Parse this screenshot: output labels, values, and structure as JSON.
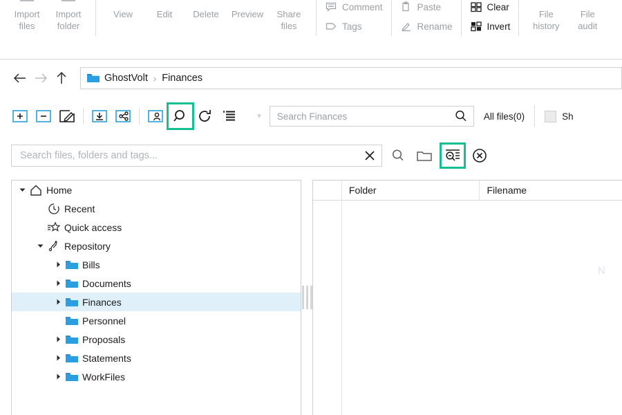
{
  "ribbon": {
    "groups": [
      {
        "name": "import",
        "buttons": [
          {
            "label_line1": "Import",
            "label_line2": "files",
            "icon": "import-files-icon"
          },
          {
            "label_line1": "Import",
            "label_line2": "folder",
            "icon": "import-folder-icon"
          }
        ]
      },
      {
        "name": "file-actions",
        "buttons": [
          {
            "label_line1": "View",
            "label_line2": "",
            "icon": "view-icon"
          },
          {
            "label_line1": "Edit",
            "label_line2": "",
            "icon": "edit-icon"
          },
          {
            "label_line1": "Delete",
            "label_line2": "",
            "icon": "delete-icon"
          },
          {
            "label_line1": "Preview",
            "label_line2": "",
            "icon": "preview-icon"
          },
          {
            "label_line1": "Share",
            "label_line2": "files",
            "icon": "share-files-icon"
          }
        ]
      },
      {
        "name": "annotate",
        "small_buttons": [
          {
            "label": "Comment",
            "icon": "comment-icon",
            "enabled": false
          },
          {
            "label": "Tags",
            "icon": "tag-icon",
            "enabled": false
          }
        ]
      },
      {
        "name": "clipboard",
        "small_buttons": [
          {
            "label": "Paste",
            "icon": "paste-icon",
            "enabled": false
          },
          {
            "label": "Rename",
            "icon": "rename-pencil-icon",
            "enabled": false
          }
        ]
      },
      {
        "name": "selection",
        "small_buttons": [
          {
            "label": "Clear",
            "icon": "clear-selection-icon",
            "enabled": true
          },
          {
            "label": "Invert",
            "icon": "invert-selection-icon",
            "enabled": true
          }
        ]
      },
      {
        "name": "history",
        "buttons": [
          {
            "label_line1": "File",
            "label_line2": "history",
            "icon": "file-history-icon"
          },
          {
            "label_line1": "File",
            "label_line2": "audit",
            "icon": "file-audit-icon"
          }
        ]
      }
    ]
  },
  "breadcrumb": {
    "back_tooltip": "Back",
    "forward_tooltip": "Forward",
    "up_tooltip": "Up",
    "root": "GhostVolt",
    "separator": "›",
    "current": "Finances"
  },
  "toolbar": {
    "buttons": [
      {
        "name": "add-folder-button",
        "icon": "folder-plus-icon",
        "highlighted": false
      },
      {
        "name": "remove-folder-button",
        "icon": "folder-minus-icon",
        "highlighted": false
      },
      {
        "name": "rename-folder-button",
        "icon": "folder-pencil-icon",
        "highlighted": false
      },
      {
        "name": "download-folder-button",
        "icon": "folder-download-icon",
        "highlighted": false
      },
      {
        "name": "share-folder-button",
        "icon": "folder-share-icon",
        "highlighted": false
      },
      {
        "name": "folder-permissions-button",
        "icon": "folder-user-icon",
        "highlighted": false
      },
      {
        "name": "search-button",
        "icon": "magnifier-icon",
        "highlighted": true
      },
      {
        "name": "refresh-button",
        "icon": "refresh-icon",
        "highlighted": false
      },
      {
        "name": "folder-options-button",
        "icon": "list-menu-icon",
        "highlighted": false
      }
    ],
    "overflow_caret": "▼",
    "highlight_color": "#13bf93"
  },
  "folder_search": {
    "placeholder": "Search Finances",
    "value": "",
    "icon": "magnifier-icon"
  },
  "file_count": {
    "label": "All files(0)"
  },
  "show_checkbox": {
    "checked": false,
    "label": "Sh"
  },
  "filter_bar": {
    "search": {
      "placeholder": "Search files, folders and tags...",
      "value": "",
      "clear_icon": "close-x-icon"
    },
    "buttons": [
      {
        "name": "run-search-button",
        "icon": "magnifier-icon",
        "highlighted": false
      },
      {
        "name": "search-in-folder-button",
        "icon": "folder-outline-icon",
        "highlighted": false
      },
      {
        "name": "search-results-view-button",
        "icon": "search-detail-icon",
        "highlighted": true
      },
      {
        "name": "close-search-button",
        "icon": "close-circle-icon",
        "highlighted": false
      }
    ]
  },
  "tree": {
    "nodes": [
      {
        "label": "Home",
        "icon": "home-icon",
        "depth": 0,
        "expander": "down",
        "selected": false
      },
      {
        "label": "Recent",
        "icon": "clock-icon",
        "depth": 1,
        "expander": "none",
        "selected": false
      },
      {
        "label": "Quick access",
        "icon": "star-dash-icon",
        "depth": 1,
        "expander": "none",
        "selected": false
      },
      {
        "label": "Repository",
        "icon": "repository-icon",
        "depth": 1,
        "expander": "down",
        "selected": false
      },
      {
        "label": "Bills",
        "icon": "folder-icon",
        "depth": 2,
        "expander": "right",
        "selected": false
      },
      {
        "label": "Documents",
        "icon": "folder-icon",
        "depth": 2,
        "expander": "right",
        "selected": false
      },
      {
        "label": "Finances",
        "icon": "folder-icon",
        "depth": 2,
        "expander": "right",
        "selected": true
      },
      {
        "label": "Personnel",
        "icon": "folder-icon",
        "depth": 2,
        "expander": "none",
        "selected": false
      },
      {
        "label": "Proposals",
        "icon": "folder-icon",
        "depth": 2,
        "expander": "right",
        "selected": false
      },
      {
        "label": "Statements",
        "icon": "folder-icon",
        "depth": 2,
        "expander": "right",
        "selected": false
      },
      {
        "label": "WorkFiles",
        "icon": "folder-icon",
        "depth": 2,
        "expander": "right",
        "selected": false
      }
    ],
    "selected_highlight": "#dff0fb"
  },
  "file_list": {
    "columns": [
      "",
      "Folder",
      "Filename"
    ],
    "rows": [],
    "empty_hint": "N"
  }
}
